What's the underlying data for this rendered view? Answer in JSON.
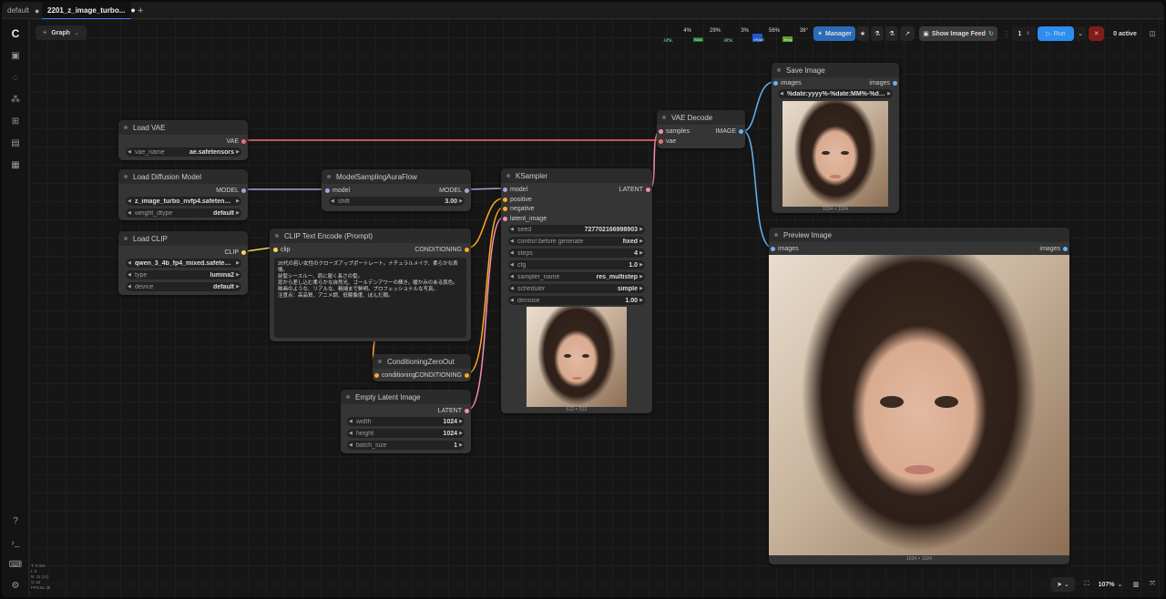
{
  "tabs": [
    {
      "label": "default",
      "dot": "●"
    },
    {
      "label": "2201_z_image_turbo...",
      "dot": "●"
    }
  ],
  "new_tab": "+",
  "toolbar": {
    "graph_label": "Graph",
    "meters": [
      {
        "name": "CPU",
        "value": "4%",
        "level": 0.04
      },
      {
        "name": "RAM",
        "value": "29%",
        "level": 0.29
      },
      {
        "name": "GPU",
        "value": "3%",
        "level": 0.03
      },
      {
        "name": "VRAM",
        "value": "56%",
        "level": 0.56
      },
      {
        "name": "Temp",
        "value": "38°",
        "level": 0.38
      }
    ],
    "manager_label": "Manager",
    "show_feed_label": "Show Image Feed",
    "queue_count": "1",
    "run_label": "Run",
    "active_label": "0 active"
  },
  "nodes": {
    "load_vae": {
      "title": "Load VAE",
      "out": "VAE",
      "vae_name_label": "vae_name",
      "vae_name": "ae.safetensors"
    },
    "load_diffusion": {
      "title": "Load Diffusion Model",
      "out": "MODEL",
      "unet_name": "z_image_turbo_nvfp4.safetens ...",
      "weight_dtype_label": "weight_dtype",
      "weight_dtype": "default"
    },
    "load_clip": {
      "title": "Load CLIP",
      "out": "CLIP",
      "clip_name": "qwen_3_4b_fp4_mixed.safeten ...",
      "type_label": "type",
      "type": "lumina2",
      "device_label": "device",
      "device": "default"
    },
    "model_sampling": {
      "title": "ModelSamplingAuraFlow",
      "in": "model",
      "out": "MODEL",
      "shift_label": "shift",
      "shift": "3.00"
    },
    "clip_text": {
      "title": "CLIP Text Encode (Prompt)",
      "in": "clip",
      "out": "CONDITIONING",
      "text": "20代の若い女性のクローズアップポートレート。ナチュラルメイク、柔らかな表情。\n前髪シースルー、肩に届く長さの髪。\n窓から差し込む柔らかな自然光、ゴールデンアワーの輝き。暖かみのある肌色。\n映画のような、リアルな、精細まで鮮明。プロフェッショナルな写真。\n注意点：高品質、アニメ調、低解像度、ぼんだ顔。"
    },
    "cond_zero": {
      "title": "ConditioningZeroOut",
      "in": "conditioning",
      "out": "CONDITIONING"
    },
    "empty_latent": {
      "title": "Empty Latent Image",
      "out": "LATENT",
      "width_label": "width",
      "width": "1024",
      "height_label": "height",
      "height": "1024",
      "batch_label": "batch_size",
      "batch": "1"
    },
    "ksampler": {
      "title": "KSampler",
      "in_model": "model",
      "in_positive": "positive",
      "in_negative": "negative",
      "in_latent": "latent_image",
      "out": "LATENT",
      "seed_label": "seed",
      "seed": "727702166998903",
      "control_label": "control before generate",
      "control": "fixed",
      "steps_label": "steps",
      "steps": "4",
      "cfg_label": "cfg",
      "cfg": "1.0",
      "sampler_label": "sampler_name",
      "sampler": "res_multistep",
      "scheduler_label": "scheduler",
      "scheduler": "simple",
      "denoise_label": "denoise",
      "denoise": "1.00",
      "caption": "512 × 512"
    },
    "vae_decode": {
      "title": "VAE Decode",
      "in_samples": "samples",
      "in_vae": "vae",
      "out": "IMAGE"
    },
    "save_image": {
      "title": "Save Image",
      "in": "images",
      "out": "images",
      "prefix": "%date:yyyy%-%date:MM%-%dat ...",
      "caption": "1024 × 1024"
    },
    "preview_image": {
      "title": "Preview Image",
      "in": "images",
      "out": "images",
      "caption": "1024 × 1024"
    }
  },
  "stats": [
    "T: 0.00s",
    "I: 0",
    "N: 11 [11]",
    "V: 32",
    "FPS:61.35"
  ],
  "bottom_bar": {
    "zoom": "107%"
  },
  "colors": {
    "vae": "#ff6b6b",
    "model": "#b39ddb",
    "clip": "#ffd54f",
    "conditioning": "#ffa726",
    "latent": "#f48fb1",
    "image": "#64b5f6",
    "accent": "#2b8ef0"
  }
}
